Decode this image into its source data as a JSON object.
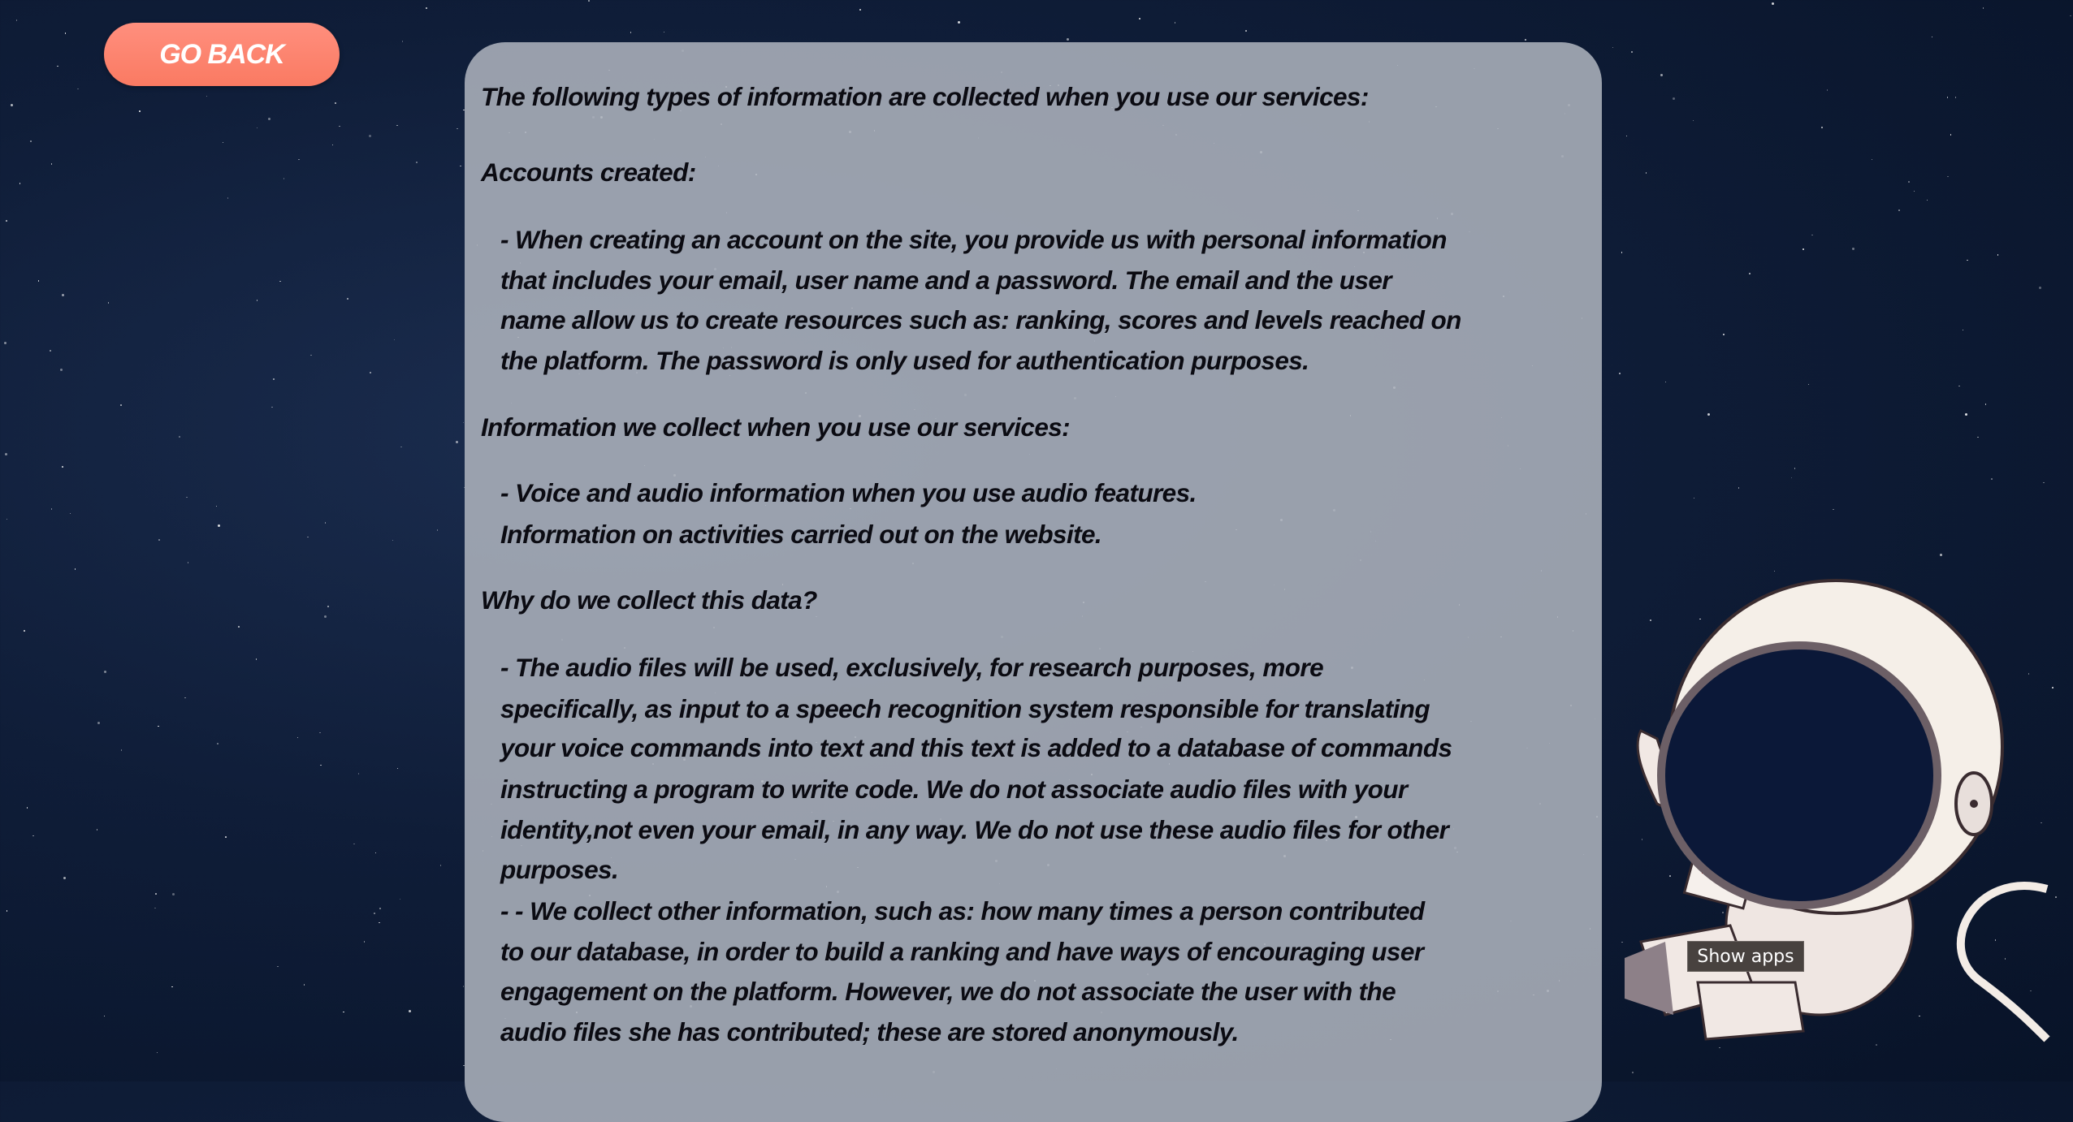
{
  "nav": {
    "go_back_label": "GO BACK"
  },
  "policy": {
    "intro": "The following types of information are collected when you use our services:",
    "accounts_heading": "Accounts created:",
    "accounts_lines": [
      "- When creating an account on the site, you provide us with personal information",
      "that includes your email, user name and a password. The email and the user",
      "name allow us to create resources such as: ranking, scores and levels reached on",
      "the platform. The password is only used for authentication purposes."
    ],
    "collect_heading": "Information we collect when you use our services:",
    "collect_lines": [
      "- Voice and audio information when you use audio features.",
      "Information on activities carried out on the website."
    ],
    "why_heading": "Why do we collect this data?",
    "why_lines": [
      "- The audio files will be used, exclusively, for research purposes, more",
      "specifically, as input to a speech recognition system responsible for translating",
      "your voice commands into text and this text is added to a database of commands",
      "instructing a program to write code. We do not associate audio files with your",
      "identity,not even your email, in any way. We do not use these audio files for other",
      "purposes.",
      "- - We collect other information, such as: how many times a person contributed",
      "to our database, in order to build a ranking and have ways of encouraging user",
      "engagement on the platform. However, we do not associate the user with the",
      "audio files she has contributed; these are stored anonymously."
    ]
  },
  "tooltip": {
    "label": "Show apps"
  },
  "colors": {
    "button": "#fa7a62",
    "background": "#0f1d38",
    "panel": "#acb2bc"
  }
}
